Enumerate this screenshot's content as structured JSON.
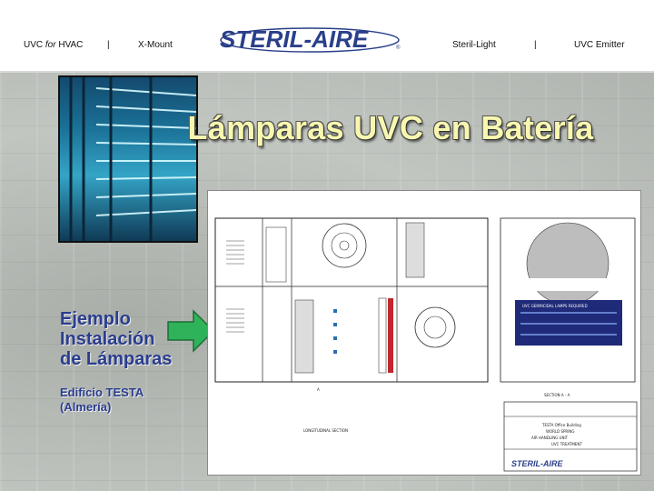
{
  "header": {
    "nav_left": [
      {
        "text_1": "UVC ",
        "text_em": "for",
        "text_2": " HVAC"
      },
      {
        "text": "|"
      },
      {
        "text": "X-Mount"
      }
    ],
    "nav_right": [
      {
        "text": "Steril-Light"
      },
      {
        "text": "|"
      },
      {
        "text": "UVC Emitter"
      }
    ],
    "logo_text": "STERIL-AIRE",
    "logo_registered": "®"
  },
  "main": {
    "title": "Lámparas UVC en Batería",
    "example_line1": "Ejemplo",
    "example_line2": "Instalación",
    "example_line3": "de Lámparas",
    "building_line1": "Edificio TESTA",
    "building_line2": "(Almería)"
  },
  "drawing": {
    "section_a_label": "A",
    "longitudinal_section": "LONGITUDINAL SECTION",
    "section_aa": "SECTION A - A",
    "uvc_banner": "UVC GERMICIDAL LAMPS REQUIRED",
    "title_block": {
      "project": "TESTA Office Building",
      "client": "WORLD SPRING",
      "desc1": "AIR HANDLING UNIT",
      "desc2": "UVC TREATMENT",
      "logo": "STERIL-AIRE"
    }
  },
  "colors": {
    "title": "#f7f7b0",
    "example_text": "#2a3d8f",
    "arrow": "#2fb35a",
    "logo": "#2a3f8a"
  }
}
